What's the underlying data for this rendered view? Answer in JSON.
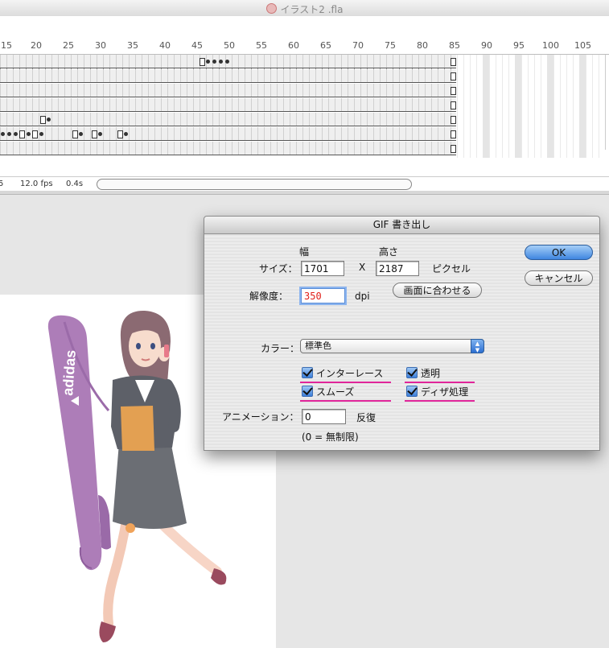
{
  "window": {
    "title": "イラスト2 .fla"
  },
  "timeline": {
    "ruler_numbers": [
      "15",
      "20",
      "25",
      "30",
      "35",
      "40",
      "45",
      "50",
      "55",
      "60",
      "65",
      "70",
      "75",
      "80",
      "85",
      "90",
      "95",
      "100",
      "105"
    ]
  },
  "status": {
    "frame_stub": "5",
    "fps": "12.0 fps",
    "time": "0.4s"
  },
  "illustration": {
    "bag_text": "adidas"
  },
  "dialog": {
    "title": "GIF 書き出し",
    "width_header": "幅",
    "height_header": "高さ",
    "size_label": "サイズ：",
    "width_value": "1701",
    "x_sep": "X",
    "height_value": "2187",
    "pixel_unit": "ピクセル",
    "resolution_label": "解像度：",
    "resolution_value": "350",
    "dpi_unit": "dpi",
    "match_screen_button": "画面に合わせる",
    "color_label": "カラー：",
    "color_selected": "標準色",
    "checkboxes": {
      "interlace": "インターレース",
      "transparent": "透明",
      "smooth": "スムーズ",
      "dither": "ディザ処理"
    },
    "animation_label": "アニメーション：",
    "animation_value": "0",
    "repeat_unit": "反復",
    "unlimited_note": "(0 = 無制限)",
    "ok_button": "OK",
    "cancel_button": "キャンセル"
  }
}
